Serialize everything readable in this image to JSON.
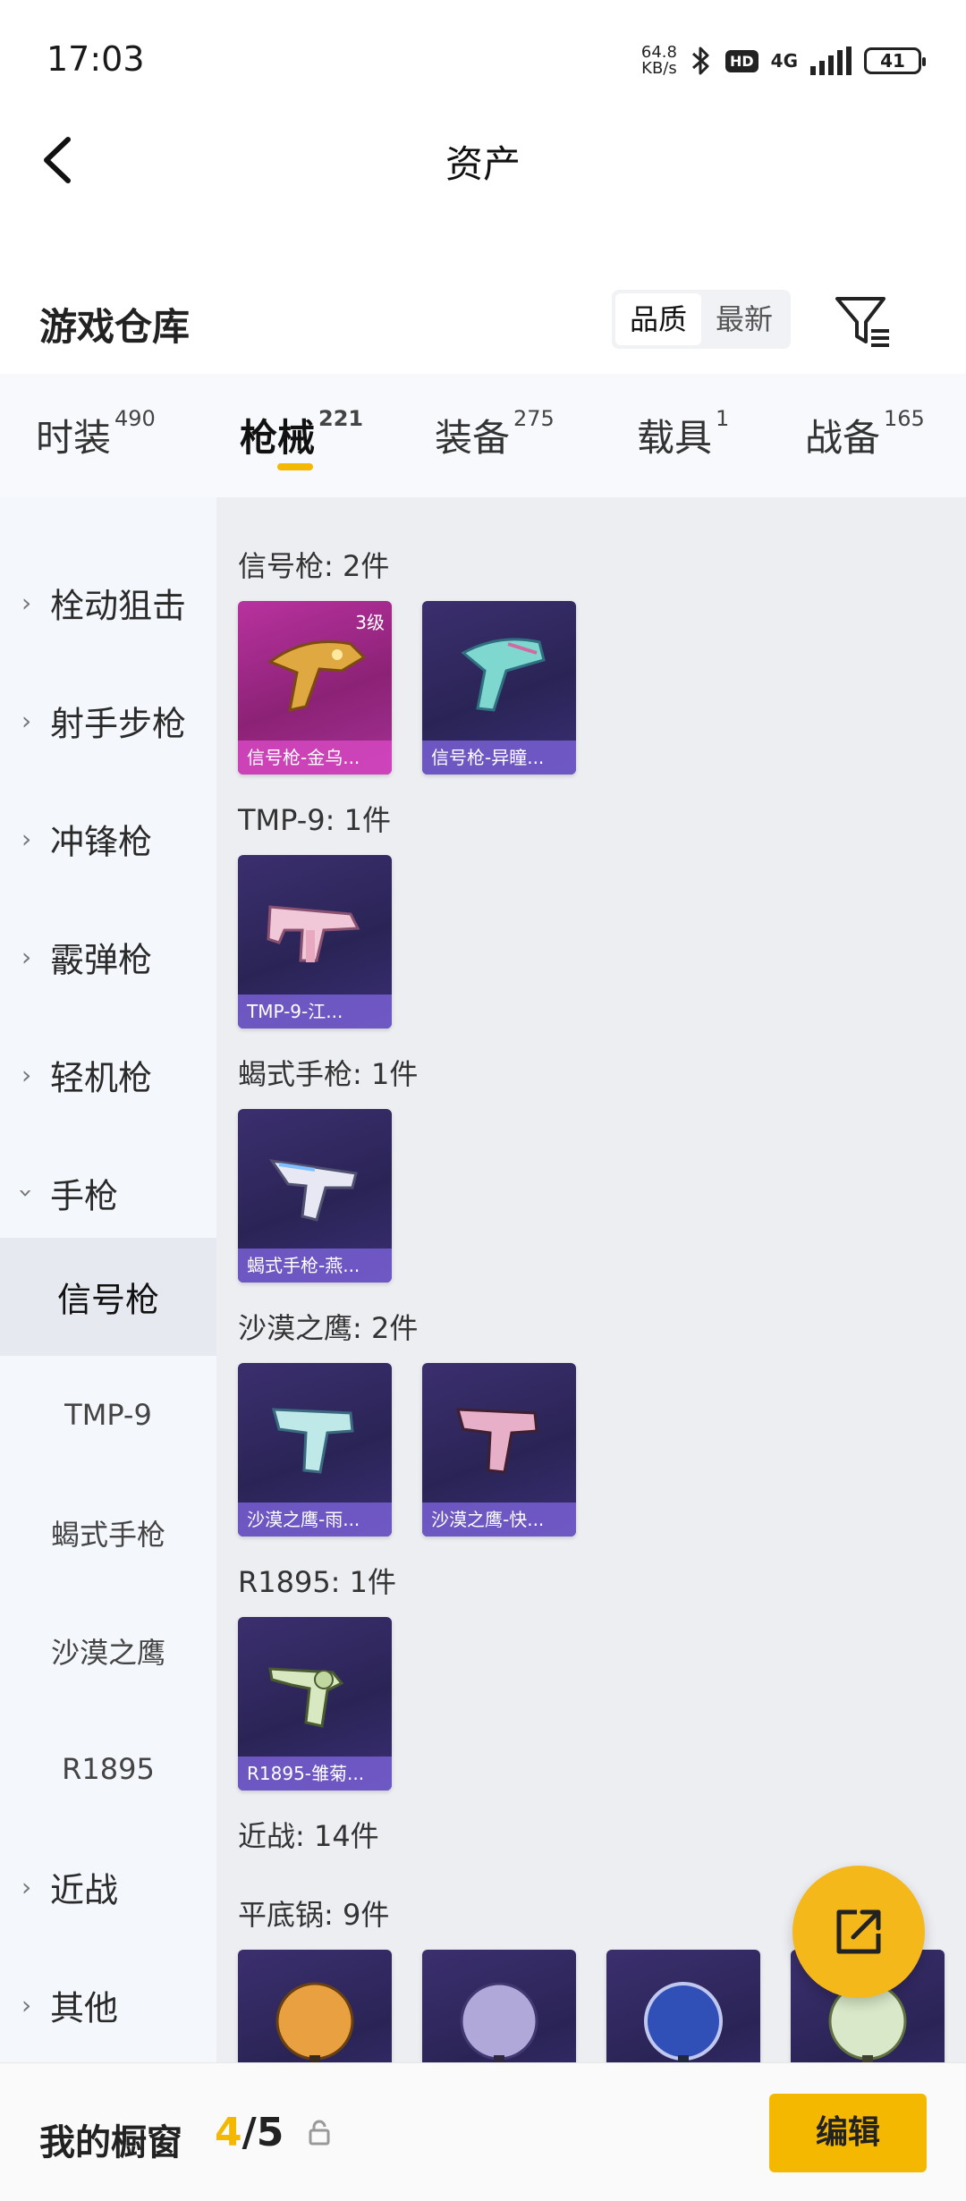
{
  "status_bar": {
    "time": "17:03",
    "net_speed_value": "64.8",
    "net_speed_unit": "KB/s",
    "hd_badge": "HD",
    "network_type": "4G",
    "battery": "41"
  },
  "header": {
    "title": "资产",
    "back_icon": "chevron-left-icon"
  },
  "section": {
    "title": "游戏仓库",
    "sort_options": [
      "品质",
      "最新"
    ],
    "sort_selected": "品质",
    "filter_icon": "filter-icon"
  },
  "tabs": [
    {
      "label": "时装",
      "count": "490"
    },
    {
      "label": "枪械",
      "count": "221",
      "active": true
    },
    {
      "label": "装备",
      "count": "275"
    },
    {
      "label": "载具",
      "count": "1"
    },
    {
      "label": "战备",
      "count": "165"
    }
  ],
  "sidebar": {
    "items": [
      {
        "label": "栓动狙击",
        "expanded": false
      },
      {
        "label": "射手步枪",
        "expanded": false
      },
      {
        "label": "冲锋枪",
        "expanded": false
      },
      {
        "label": "霰弹枪",
        "expanded": false
      },
      {
        "label": "轻机枪",
        "expanded": false
      },
      {
        "label": "手枪",
        "expanded": true
      },
      {
        "label": "信号枪",
        "sub": true,
        "active": true
      },
      {
        "label": "TMP-9",
        "sub": true
      },
      {
        "label": "蝎式手枪",
        "sub": true
      },
      {
        "label": "沙漠之鹰",
        "sub": true
      },
      {
        "label": "R1895",
        "sub": true
      },
      {
        "label": "近战",
        "expanded": false
      },
      {
        "label": "其他",
        "expanded": false
      }
    ]
  },
  "groups": [
    {
      "label": "信号枪: 2件",
      "items": [
        {
          "name": "信号枪-金乌...",
          "level": "3级",
          "style": "gold"
        },
        {
          "name": "信号枪-异瞳...",
          "style": "purple"
        }
      ]
    },
    {
      "label": "TMP-9: 1件",
      "items": [
        {
          "name": "TMP-9-江...",
          "style": "purple"
        }
      ]
    },
    {
      "label": "蝎式手枪: 1件",
      "items": [
        {
          "name": "蝎式手枪-燕...",
          "style": "purple"
        }
      ]
    },
    {
      "label": "沙漠之鹰: 2件",
      "items": [
        {
          "name": "沙漠之鹰-雨...",
          "style": "purple"
        },
        {
          "name": "沙漠之鹰-快...",
          "style": "purple"
        }
      ]
    },
    {
      "label": "R1895: 1件",
      "items": [
        {
          "name": "R1895-雏菊...",
          "style": "purple"
        }
      ]
    },
    {
      "label": "近战: 14件",
      "items": []
    },
    {
      "label": "平底锅: 9件",
      "items": [
        {
          "name": "",
          "style": "purple"
        },
        {
          "name": "",
          "style": "purple"
        },
        {
          "name": "",
          "style": "purple"
        },
        {
          "name": "",
          "style": "purple"
        }
      ]
    }
  ],
  "fab": {
    "icon": "share-out-icon"
  },
  "bottom_bar": {
    "label": "我的橱窗",
    "count_current": "4",
    "count_sep_total": "/5",
    "lock_icon": "lock-icon",
    "edit_button": "编辑"
  },
  "colors": {
    "accent": "#f5b800",
    "card_purple": "#2a2456",
    "card_gold": "#8c2276"
  }
}
